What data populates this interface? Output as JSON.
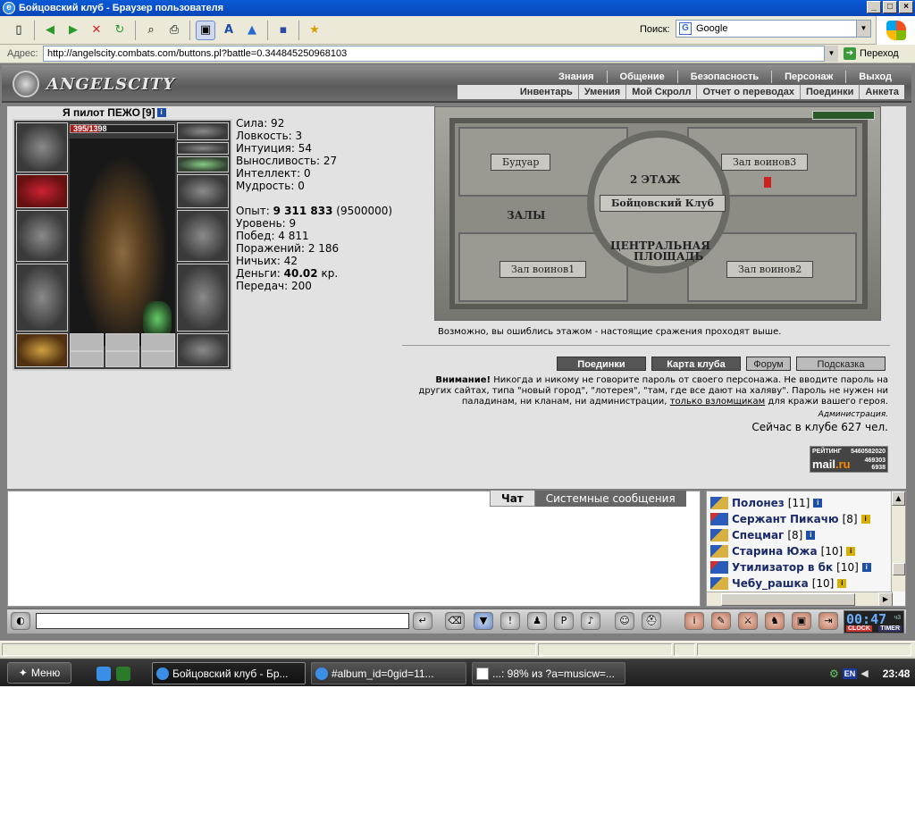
{
  "window": {
    "title": "Бойцовский клуб - Браузер пользователя"
  },
  "toolbar": {
    "search_label": "Поиск:",
    "search_engine": "Google"
  },
  "address": {
    "label": "Адрес:",
    "url": "http://angelscity.combats.com/buttons.pl?battle=0.344845250968103",
    "go_label": "Переход"
  },
  "site": {
    "logo_text": "ANGELSCITY",
    "top_menu": [
      "Знания",
      "Общение",
      "Безопасность",
      "Персонаж",
      "Выход"
    ],
    "sub_menu": [
      "Инвентарь",
      "Умения",
      "Мой Скролл",
      "Отчет о переводах",
      "Поединки",
      "Анкета"
    ]
  },
  "character": {
    "name": "Я пилот ПЕЖО",
    "level_tag": "[9]",
    "hp_current": "395",
    "hp_max": "1398",
    "hp_text": "395/1398",
    "hp_fraction": 0.28,
    "stats": [
      "Сила: 92",
      "Ловкость: 3",
      "Интуиция: 54",
      "Выносливость: 27",
      "Интеллект: 0",
      "Мудрость: 0"
    ],
    "exp_label": "Опыт:",
    "exp_value": "9 311 833",
    "exp_next": "(9500000)",
    "details": [
      "Уровень: 9",
      "Побед: 4 811",
      "Поражений: 2 186",
      "Ничьих: 42"
    ],
    "money_label": "Деньги:",
    "money_value": "40.02",
    "money_unit": "кр.",
    "transfers": "Передач: 200"
  },
  "map": {
    "rooms": [
      "Будуар",
      "Зал воинов3",
      "Зал воинов1",
      "Зал воинов2"
    ],
    "floor": "2 ЭТАЖ",
    "club": "Бойцовский Клуб",
    "halls": "ЗАЛЫ",
    "center_line1": "ЦЕНТРАЛЬНАЯ",
    "center_line2": "ПЛОЩАДЬ",
    "note": "Возможно, вы ошиблись этажом - настоящие сражения проходят выше."
  },
  "nav_buttons": [
    "Поединки",
    "Карта клуба",
    "Форум",
    "Подсказка"
  ],
  "warning": {
    "bold": "Внимание!",
    "text1": "Никогда и никому не говорите пароль от своего персонажа. Не вводите пароль на других сайтах, типа \"новый город\", \"лотерея\", \"там, где все дают на халяву\". Пароль не нужен ни паладинам, ни кланам, ни администрации,",
    "link": "только взломщикам",
    "text2": "для кражи вашего героя.",
    "signature": "Администрация."
  },
  "online": "Сейчас в клубе 627 чел.",
  "counter": {
    "label": "РЕЙТИНГ",
    "mail": "mail",
    "ru": ".ru",
    "n1": "5460582020",
    "n2": "469303",
    "n3": "6938"
  },
  "chat": {
    "tabs": [
      "Чат",
      "Системные сообщения"
    ]
  },
  "users": [
    {
      "name": "Полонез",
      "level": "[11]",
      "badge": "i"
    },
    {
      "name": "Сержант Пикачю",
      "level": "[8]",
      "badge": "i"
    },
    {
      "name": "Спецмаг",
      "level": "[8]",
      "badge": "i"
    },
    {
      "name": "Старина Южа",
      "level": "[10]",
      "badge": "i"
    },
    {
      "name": "Утилизатор в бк",
      "level": "[10]",
      "badge": "i"
    },
    {
      "name": "Чебу_рашка",
      "level": "[10]",
      "badge": "i"
    }
  ],
  "clock": {
    "time": "00:47",
    "sub": "ч3",
    "l1": "CLOCK",
    "l2": "TIMER"
  },
  "taskbar": {
    "start_label": "Меню",
    "tasks": [
      "Бойцовский клуб - Бр...",
      "#album_id=0gid=11...",
      "...: 98% из ?a=musicw=..."
    ],
    "lang": "EN",
    "time": "23:48"
  },
  "colors": {
    "title_blue": "#0a5ad6",
    "hp_red": "#b01818",
    "user_name": "#1a2a6a"
  }
}
